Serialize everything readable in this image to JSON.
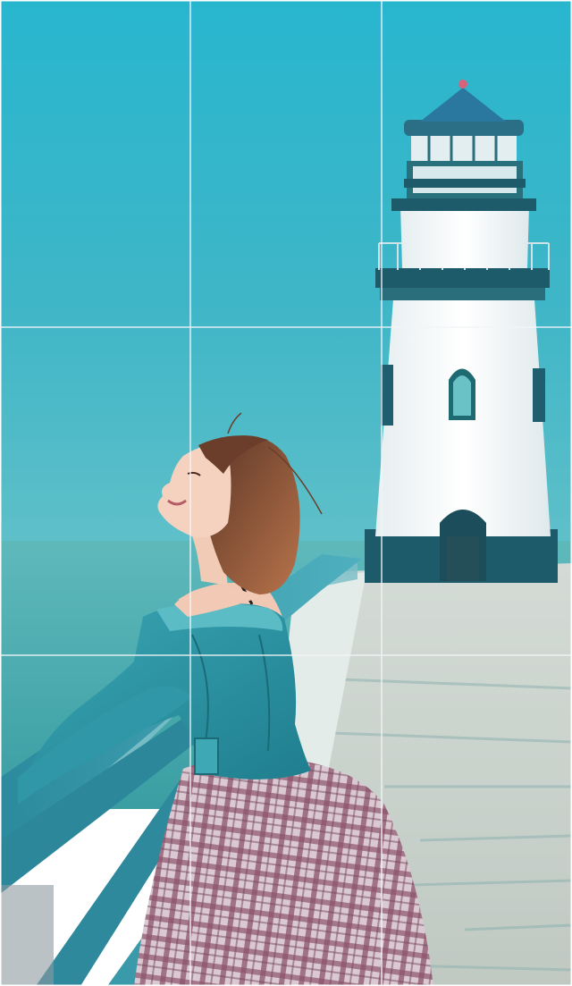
{
  "scene": {
    "subject": "woman-leaning-on-railing",
    "background": "lighthouse-on-pier",
    "overlay": "rule-of-thirds-grid"
  },
  "grid": {
    "columns": 3,
    "rows": 3,
    "line_color": "#f2f5f7"
  },
  "palette": {
    "sky_top": "#2fb8cf",
    "sky_bottom": "#4fb9c8",
    "sea": "#3ea3a7",
    "lighthouse_white": "#f3f7f8",
    "lighthouse_trim": "#1d5a6a",
    "denim": "#2f93a3",
    "skirt": "#b99aa6",
    "hair": "#9a5a3a",
    "skin": "#f3cdb9",
    "railing": "#2f8ea0",
    "pier": "#cfd6cf"
  },
  "icons": {
    "lighthouse": "lighthouse-icon",
    "person": "person-icon"
  }
}
